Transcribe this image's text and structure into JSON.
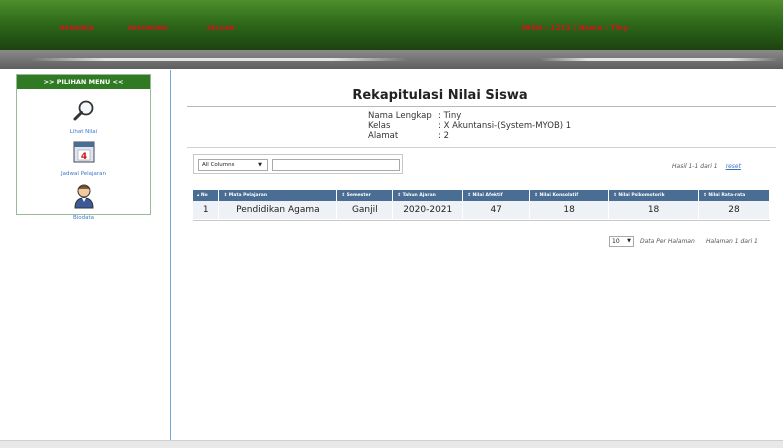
{
  "nav": {
    "beranda": "BERANDA",
    "password": "PASSWORD",
    "keluar": "KELUAR",
    "user_info": "NISN : 1213 | Nama : Tiny"
  },
  "sidebar": {
    "header": ">> PILIHAN MENU <<",
    "items": [
      {
        "label": "Lihat Nilai",
        "icon": "magnifier-icon"
      },
      {
        "label": "Jadwal Pelajaran",
        "icon": "calendar-icon"
      },
      {
        "label": "Biodata",
        "icon": "user-icon"
      }
    ]
  },
  "main": {
    "title": "Rekapitulasi Nilai Siswa",
    "student": {
      "nama_label": "Nama Lengkap",
      "nama_value": ": Tiny",
      "kelas_label": "Kelas",
      "kelas_value": ": X Akuntansi-(System-MYOB) 1",
      "alamat_label": "Alamat",
      "alamat_value": ": 2"
    },
    "filter": {
      "select_value": "All Columns",
      "search_value": ""
    },
    "result_info": "Hasil 1-1 dari 1",
    "reset_label": "reset",
    "table": {
      "headers": [
        "▴ No",
        "⇕ Mata Pelajaran",
        "⇕ Semester",
        "⇕ Tahun Ajaran",
        "⇕ Nilai Afektif",
        "⇕ Nilai Konsolatif",
        "⇕ Nilai Psikomotorik",
        "⇕ Nilai Rata-rata"
      ],
      "rows": [
        [
          "1",
          "Pendidikan Agama",
          "Ganjil",
          "2020-2021",
          "47",
          "18",
          "18",
          "28"
        ]
      ]
    },
    "pagination": {
      "page_size": "10",
      "per_page_label": "Data Per Halaman",
      "page_of": "Halaman 1 dari 1"
    }
  },
  "colors": {
    "topbar": "#2f6a1a",
    "nav_text": "#d4141a",
    "table_header": "#4a6d94",
    "menu_header": "#2f7a22",
    "link": "#3e78c8"
  }
}
